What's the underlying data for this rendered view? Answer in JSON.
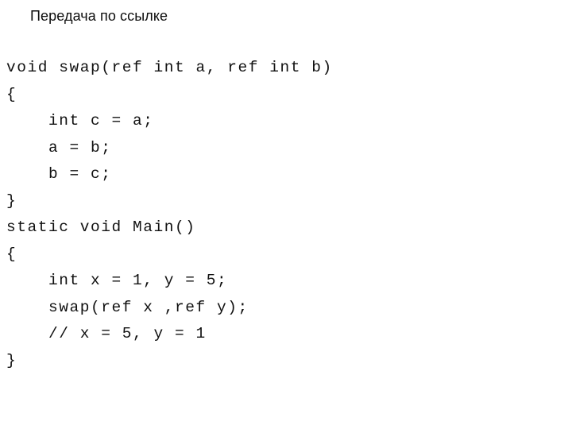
{
  "slide": {
    "title": "Передача по ссылке",
    "background_color": "#ffffff",
    "text_color": "#111111",
    "code_lines": [
      "void swap(ref int a, ref int b)",
      "{",
      "    int c = a;",
      "    a = b;",
      "    b = c;",
      "}",
      "static void Main()",
      "{",
      "    int x = 1, y = 5;",
      "    swap(ref x ,ref y);",
      "    // x = 5, y = 1",
      "}"
    ]
  }
}
